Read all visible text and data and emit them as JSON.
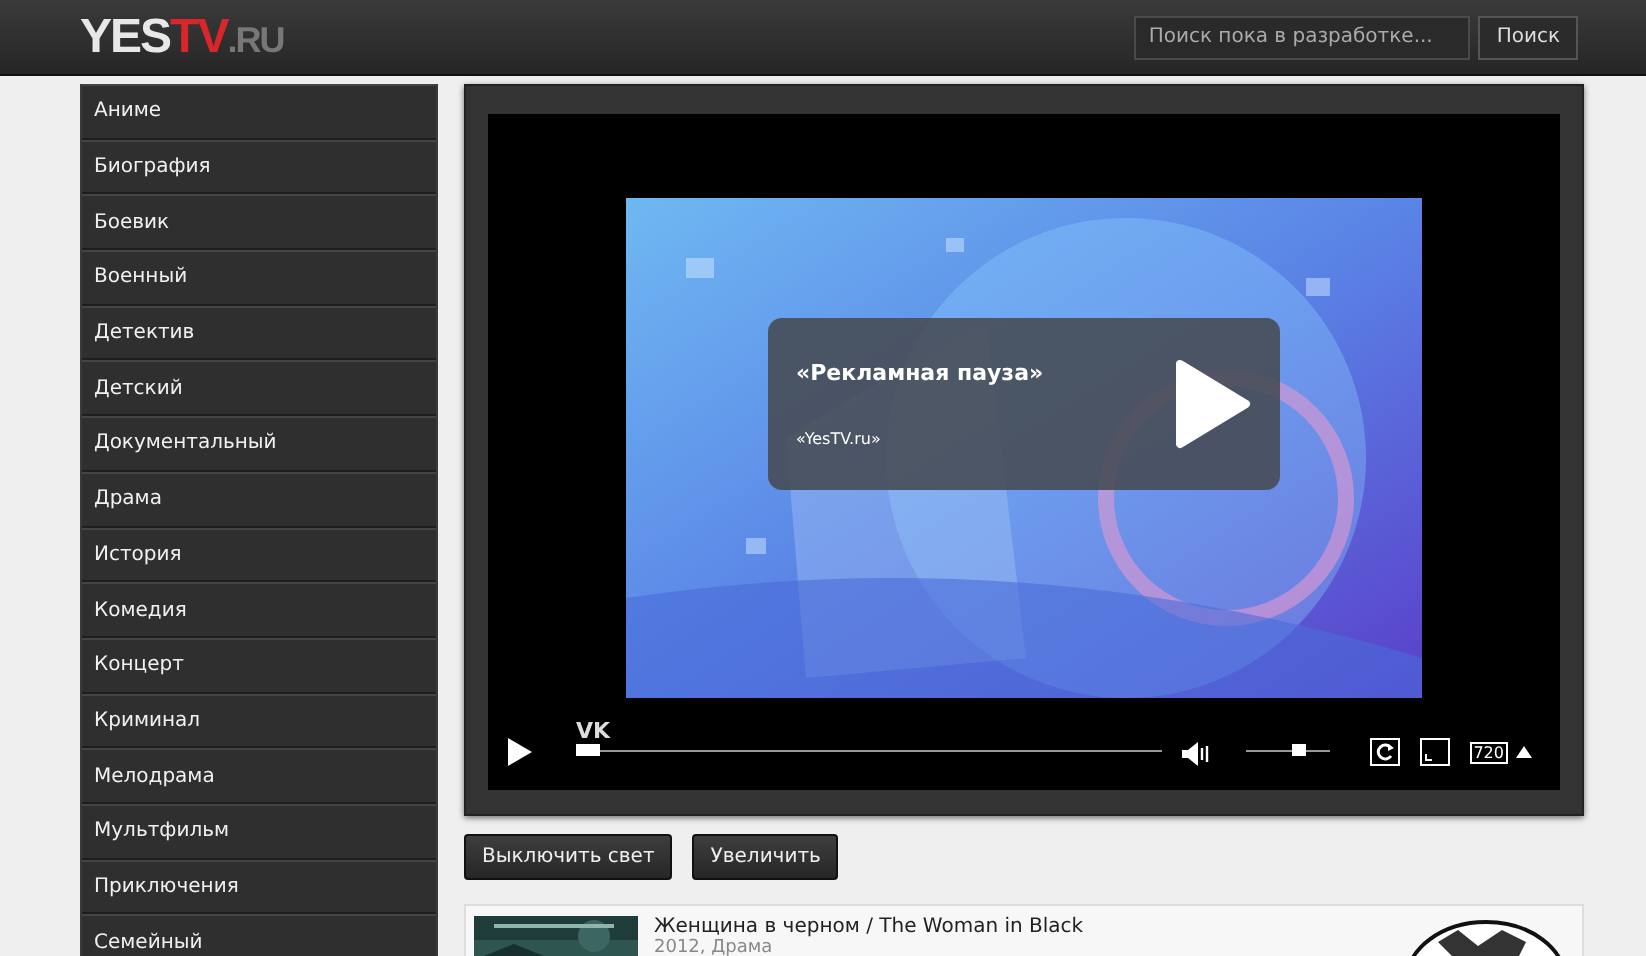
{
  "header": {
    "logo": [
      {
        "text": "YES",
        "kind": "plain"
      },
      {
        "text": "TV",
        "kind": "accent"
      },
      {
        "text": ".RU",
        "kind": "muted"
      }
    ],
    "search": {
      "placeholder": "Поиск пока в разработке..."
    },
    "search_button": "Поиск"
  },
  "sidebar": {
    "items": [
      {
        "label": "Аниме"
      },
      {
        "label": "Биография"
      },
      {
        "label": "Боевик"
      },
      {
        "label": "Военный"
      },
      {
        "label": "Детектив"
      },
      {
        "label": "Детский"
      },
      {
        "label": "Документальный"
      },
      {
        "label": "Драма"
      },
      {
        "label": "История"
      },
      {
        "label": "Комедия"
      },
      {
        "label": "Концерт"
      },
      {
        "label": "Криминал"
      },
      {
        "label": "Мелодрама"
      },
      {
        "label": "Мультфильм"
      },
      {
        "label": "Приключения"
      },
      {
        "label": "Семейный"
      }
    ]
  },
  "player": {
    "overlay": {
      "title": "«Рекламная пауза»",
      "subtitle": "«YesTV.ru»"
    },
    "source": "VK",
    "progress": {
      "level": 0.02
    },
    "volume": {
      "level": 0.62
    },
    "quality": "720"
  },
  "actions": [
    "Выключить свет",
    "Увеличить"
  ],
  "movie": {
    "title": "Женщина в черном / The Woman in Black",
    "meta": "2012, Драма"
  }
}
